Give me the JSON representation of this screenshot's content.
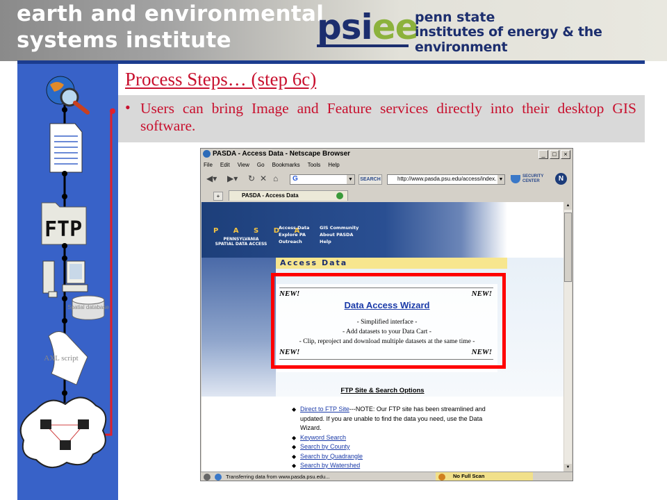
{
  "header": {
    "title_line1": "earth and environmental",
    "title_line2": "systems institute",
    "logo_ps": "psi",
    "logo_ee": "ee",
    "logo_text_line1": "penn state",
    "logo_text_line2": "institutes of energy & the environment"
  },
  "sidebar": {
    "diagram_labels": {
      "ftp": "FTP",
      "spatial_db": "Spatial database",
      "axl": "AXL script"
    }
  },
  "slide": {
    "title": "Process Steps… (step 6c)",
    "bullet": "Users can bring Image and Feature services directly into their desktop GIS software."
  },
  "browser": {
    "window_title": "PASDA - Access Data - Netscape Browser",
    "window_buttons": [
      "_",
      "□",
      "×"
    ],
    "menu": [
      "File",
      "Edit",
      "View",
      "Go",
      "Bookmarks",
      "Tools",
      "Help"
    ],
    "search_button": "SEARCH",
    "url": "http://www.pasda.psu.edu/access/index.",
    "security_center": "SECURITY CENTER",
    "tab_label": "PASDA - Access Data",
    "status_text": "Transferring data from www.pasda.psu.edu...",
    "status_right": "No Full Scan"
  },
  "page": {
    "logo": "P A S D A",
    "logo_sub": "PENNSYLVANIA SPATIAL DATA ACCESS",
    "nav_col1": [
      "Access Data",
      "Explore PA",
      "Outreach"
    ],
    "nav_col2": [
      "GIS Community",
      "About PASDA",
      "Help"
    ],
    "access_bar": "Access Data",
    "new_label": "NEW!",
    "wizard_title": "Data Access Wizard",
    "wizard_lines": [
      "- Simplified interface -",
      "- Add datasets to your Data Cart -",
      "- Clip, reproject and download multiple datasets at the same time -"
    ],
    "ftp_title": "FTP Site & Search Options",
    "ftp_first_link": "Direct to FTP Site",
    "ftp_first_note": "---NOTE: Our FTP site has been streamlined and updated. If you are unable to find the data you need, use the Data Wizard.",
    "ftp_links": [
      "Keyword Search",
      "Search by County",
      "Search by Quadrangle",
      "Search by Watershed"
    ]
  },
  "colors": {
    "accent_red": "#c8102e",
    "sidebar_blue": "#3862c8",
    "highlight_box": "#ff0000"
  }
}
